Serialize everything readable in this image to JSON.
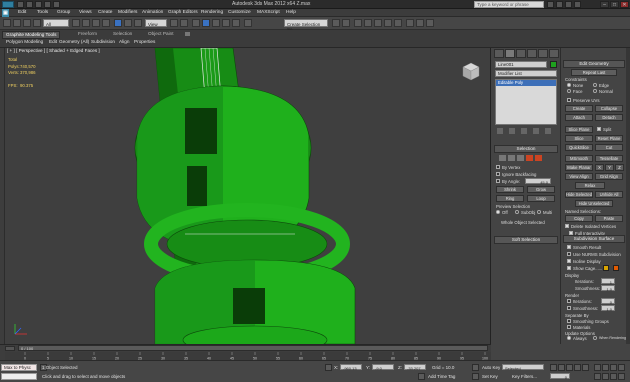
{
  "window": {
    "title": "Autodesk 3ds Max 2012 x64    Z.max",
    "search_placeholder": "Type a keyword or phrase",
    "controls": [
      "–",
      "□",
      "✕"
    ]
  },
  "menu": [
    "Edit",
    "Tools",
    "Group",
    "Views",
    "Create",
    "Modifiers",
    "Animation",
    "Graph Editors",
    "Rendering",
    "Customize",
    "MAXScript",
    "Help"
  ],
  "toolbar": {
    "undo_label": "↶",
    "filter_select": "All",
    "view_select": "View",
    "named_sets_select": "Create Selection Se"
  },
  "ribbon": {
    "tabs": [
      "Graphite Modeling Tools",
      "Freeform",
      "Selection",
      "Object Paint"
    ],
    "active_tab_index": 0,
    "subtabs": [
      "Polygon Modeling",
      "Edit",
      "Geometry (All)",
      "Subdivision",
      "Align",
      "Properties"
    ]
  },
  "viewport": {
    "label": "[ + ] [ Perspective ] [ Shaded + Edged Faces ]",
    "stats": {
      "total_label": "Total",
      "polys_label": "Polys:",
      "polys_value": "740,570",
      "verts_label": "Verts:",
      "verts_value": "370,986",
      "fps_label": "FPS:",
      "fps_value": "90.375"
    },
    "object_color": "#1fa81c"
  },
  "command_panel": {
    "object_name": "Line001",
    "object_color": "#1ea01e",
    "modifier_list": "Modifier List",
    "stack_item": "Editable Poly",
    "selection_rollout": "Selection",
    "by_vertex": "By Vertex",
    "ignore_backfacing": "Ignore Backfacing",
    "by_angle": "By Angle:",
    "by_angle_value": "45.0",
    "shrink": "Shrink",
    "grow": "Grow",
    "ring": "Ring",
    "loop": "Loop",
    "preview_selection": "Preview Selection",
    "preview_off": "Off",
    "preview_subobj": "SubObj",
    "preview_multi": "Multi",
    "whole_object_selected": "Whole Object Selected",
    "soft_selection": "Soft Selection"
  },
  "edit_geometry": {
    "title": "Edit Geometry",
    "repeat_last": "Repeat Last",
    "constraints": "Constraints",
    "none": "None",
    "edge": "Edge",
    "face": "Face",
    "normal": "Normal",
    "preserve_uvs": "Preserve UVs",
    "create": "Create",
    "collapse": "Collapse",
    "attach": "Attach",
    "detach": "Detach",
    "slice_plane": "Slice Plane",
    "split": "Split",
    "slice": "Slice",
    "reset_plane": "Reset Plane",
    "quickslice": "QuickSlice",
    "cut": "Cut",
    "msmooth": "MSmooth",
    "tessellate": "Tessellate",
    "make_planar": "Make Planar",
    "x": "X",
    "y": "Y",
    "z": "Z",
    "view_align": "View Align",
    "grid_align": "Grid Align",
    "relax": "Relax",
    "hide_selected": "Hide Selected",
    "unhide_all": "Unhide All",
    "hide_unselected": "Hide Unselected",
    "named_selections": "Named Selections:",
    "copy": "Copy",
    "paste": "Paste",
    "delete_isolated": "Delete Isolated Vertices",
    "full_interactivity": "Full Interactivity",
    "subdivision_surface": "Subdivision Surface",
    "smooth_result": "Smooth Result",
    "use_nurms": "Use NURMS Subdivision",
    "isoline_display": "Isoline Display",
    "show_cage": "Show Cage......",
    "cage_color_1": "#d9a300",
    "cage_color_2": "#e05a00",
    "display": "Display",
    "iterations_label": "Iterations:",
    "iterations_value": "1",
    "smoothness_label": "Smoothness:",
    "smoothness_value": "1.0",
    "render": "Render",
    "render_iterations_value": "0",
    "render_smoothness_value": "1.0",
    "separate_by": "Separate By",
    "smoothing_groups": "Smoothing Groups",
    "materials": "Materials",
    "update_options": "Update Options",
    "always": "Always",
    "when_rendering": "When Rendering",
    "manually": "Manually"
  },
  "timeline": {
    "frame_label": "0 / 100",
    "ticks": [
      "0",
      "5",
      "10",
      "15",
      "20",
      "25",
      "30",
      "35",
      "40",
      "45",
      "50",
      "55",
      "60",
      "65",
      "70",
      "75",
      "80",
      "85",
      "90",
      "95",
      "100"
    ]
  },
  "status": {
    "maxscript": "Max to Physc",
    "selected": "1 Object Selected",
    "prompt": "Click and drag to select and move objects",
    "x_label": "X:",
    "x_value": "-960.13",
    "y_label": "Y:",
    "y_value": "-9.0",
    "z_label": "Z:",
    "z_value": "-33.207",
    "grid": "Grid = 10.0",
    "add_time_tag": "Add Time Tag",
    "auto_key": "Auto Key",
    "set_key": "Set Key",
    "selected_select": "Selected",
    "key_filters": "Key Filters...",
    "frame_value": "0"
  }
}
